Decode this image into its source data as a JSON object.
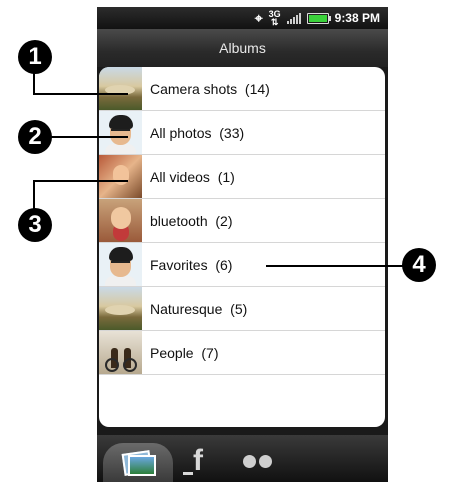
{
  "status_bar": {
    "time": "9:38 PM",
    "network": "3G",
    "icons": [
      "gps-icon",
      "3g-icon",
      "signal-icon",
      "battery-icon"
    ]
  },
  "title_bar": {
    "title": "Albums"
  },
  "albums": [
    {
      "label": "Camera shots  (14)",
      "thumb": "landscape"
    },
    {
      "label": "All photos  (33)",
      "thumb": "face"
    },
    {
      "label": "All videos  (1)",
      "thumb": "video"
    },
    {
      "label": "bluetooth  (2)",
      "thumb": "kid"
    },
    {
      "label": "Favorites  (6)",
      "thumb": "face"
    },
    {
      "label": "Naturesque  (5)",
      "thumb": "landscape"
    },
    {
      "label": "People  (7)",
      "thumb": "people"
    }
  ],
  "bottom_tabs": [
    {
      "name": "albums-tab",
      "active": true
    },
    {
      "name": "facebook-tab",
      "glyph": "f",
      "active": false
    },
    {
      "name": "flickr-tab",
      "active": false
    }
  ],
  "callouts": [
    "1",
    "2",
    "3",
    "4"
  ],
  "colors": {
    "background": "#ffffff",
    "phone_chrome": "#1a1a1a",
    "battery": "#3bd23b"
  }
}
